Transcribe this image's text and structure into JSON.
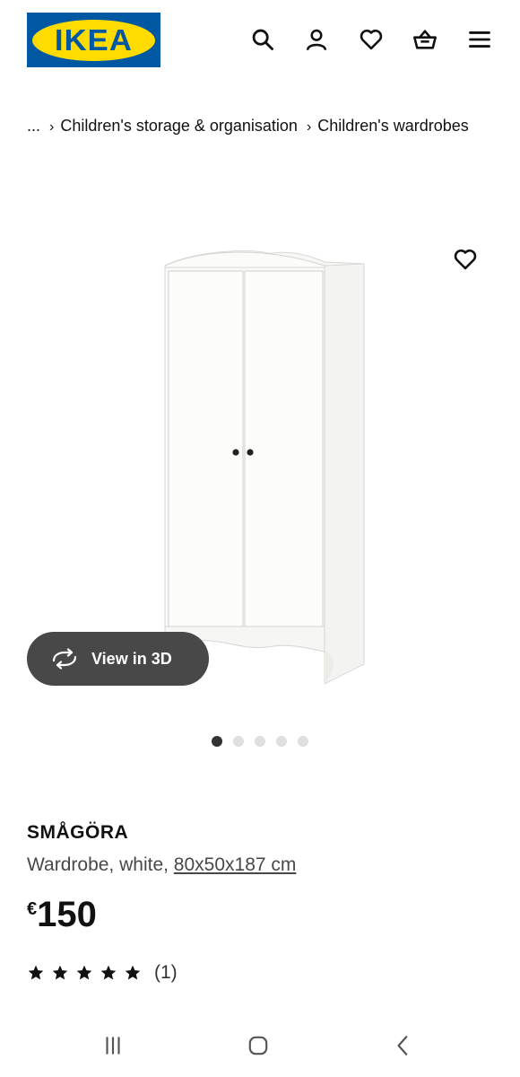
{
  "header": {
    "logo_text": "IKEA",
    "icons": [
      "search-icon",
      "account-icon",
      "heart-icon",
      "basket-icon",
      "menu-icon"
    ]
  },
  "breadcrumb": {
    "ellipsis": "...",
    "items": [
      "Children's storage & organisation",
      "Children's wardrobes"
    ]
  },
  "gallery": {
    "view_3d_label": "View in 3D",
    "slide_count": 5,
    "active_slide": 1
  },
  "product": {
    "name": "SMÅGÖRA",
    "description": "Wardrobe, white, ",
    "dimensions": "80x50x187 cm",
    "currency": "€",
    "price": "150",
    "rating_stars": 5,
    "rating_count": "(1)"
  },
  "colors": {
    "ikea_blue": "#0058a3",
    "ikea_yellow": "#ffdb00",
    "button_dark": "#484848"
  },
  "system_nav": {
    "icons": [
      "recent-apps-icon",
      "home-icon",
      "back-icon"
    ]
  }
}
